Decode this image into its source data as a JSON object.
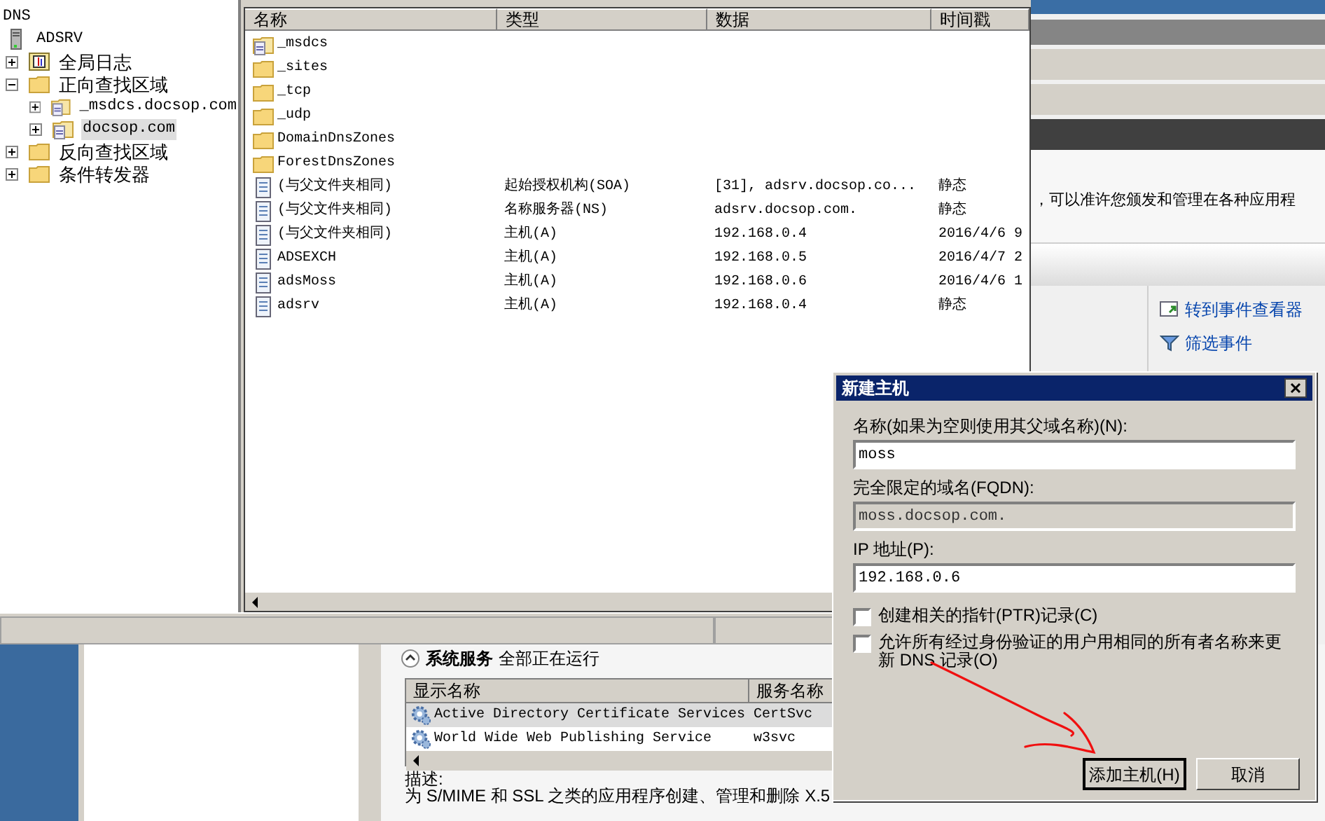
{
  "dns_window": {
    "tree": {
      "label": "DNS",
      "children": [
        {
          "label": "ADSRV",
          "kind": "server",
          "selected": false,
          "children": [
            {
              "label": "全局日志",
              "kind": "log",
              "expanded": false,
              "selected": false
            },
            {
              "label": "正向查找区域",
              "kind": "folder",
              "expanded": true,
              "selected": false,
              "children": [
                {
                  "label": "_msdcs.docsop.com",
                  "kind": "zone",
                  "expanded": false,
                  "selected": false
                },
                {
                  "label": "docsop.com",
                  "kind": "zone",
                  "expanded": false,
                  "selected": true
                }
              ]
            },
            {
              "label": "反向查找区域",
              "kind": "folder",
              "expanded": false,
              "selected": false
            },
            {
              "label": "条件转发器",
              "kind": "folder",
              "expanded": false,
              "selected": false
            }
          ]
        }
      ]
    },
    "columns": [
      "名称",
      "类型",
      "数据",
      "时间戳"
    ],
    "rows": [
      {
        "kind": "zone",
        "cells": [
          "_msdcs"
        ]
      },
      {
        "kind": "folder",
        "cells": [
          "_sites"
        ]
      },
      {
        "kind": "folder",
        "cells": [
          "_tcp"
        ]
      },
      {
        "kind": "folder",
        "cells": [
          "_udp"
        ]
      },
      {
        "kind": "folder",
        "cells": [
          "DomainDnsZones"
        ]
      },
      {
        "kind": "folder",
        "cells": [
          "ForestDnsZones"
        ]
      },
      {
        "kind": "record",
        "cells": [
          "(与父文件夹相同)",
          "起始授权机构(SOA)",
          "[31], adsrv.docsop.co...",
          "静态"
        ]
      },
      {
        "kind": "record",
        "cells": [
          "(与父文件夹相同)",
          "名称服务器(NS)",
          "adsrv.docsop.com.",
          "静态"
        ]
      },
      {
        "kind": "record",
        "cells": [
          "(与父文件夹相同)",
          "主机(A)",
          "192.168.0.4",
          "2016/4/6 9"
        ]
      },
      {
        "kind": "record",
        "cells": [
          "ADSEXCH",
          "主机(A)",
          "192.168.0.5",
          "2016/4/7 2"
        ]
      },
      {
        "kind": "record",
        "cells": [
          "adsMoss",
          "主机(A)",
          "192.168.0.6",
          "2016/4/6 1"
        ]
      },
      {
        "kind": "record",
        "cells": [
          "adsrv",
          "主机(A)",
          "192.168.0.4",
          "静态"
        ]
      }
    ]
  },
  "server_manager": {
    "intro_text": "，可以准许您颁发和管理在各种应用程",
    "links": [
      "转到事件查看器",
      "筛选事件"
    ],
    "services_section": {
      "title": "系统服务",
      "status": "全部正在运行",
      "expanded": true,
      "columns": [
        "显示名称",
        "服务名称"
      ],
      "rows": [
        {
          "cells": [
            "Active Directory Certificate Services",
            "CertSvc"
          ],
          "selected": true
        },
        {
          "cells": [
            "World Wide Web Publishing Service",
            "w3svc"
          ],
          "selected": false
        }
      ],
      "description_label": "描述:",
      "description": "为 S/MIME 和 SSL 之类的应用程序创建、管理和删除 X.5"
    }
  },
  "dialog": {
    "title": "新建主机",
    "fields": [
      {
        "label": "名称(如果为空则使用其父域名称)(N):",
        "value": "moss",
        "disabled": false
      },
      {
        "label": "完全限定的域名(FQDN):",
        "value": "moss.docsop.com.",
        "disabled": true
      },
      {
        "label": "IP 地址(P):",
        "value": "192.168.0.6",
        "disabled": false
      }
    ],
    "checkboxes": [
      {
        "label": "创建相关的指针(PTR)记录(C)",
        "checked": false
      },
      {
        "label": "允许所有经过身份验证的用户用相同的所有者名称来更新 DNS 记录(O)",
        "checked": false
      }
    ],
    "buttons": [
      {
        "label": "添加主机(H)",
        "default": true
      },
      {
        "label": "取消",
        "default": false
      }
    ]
  }
}
